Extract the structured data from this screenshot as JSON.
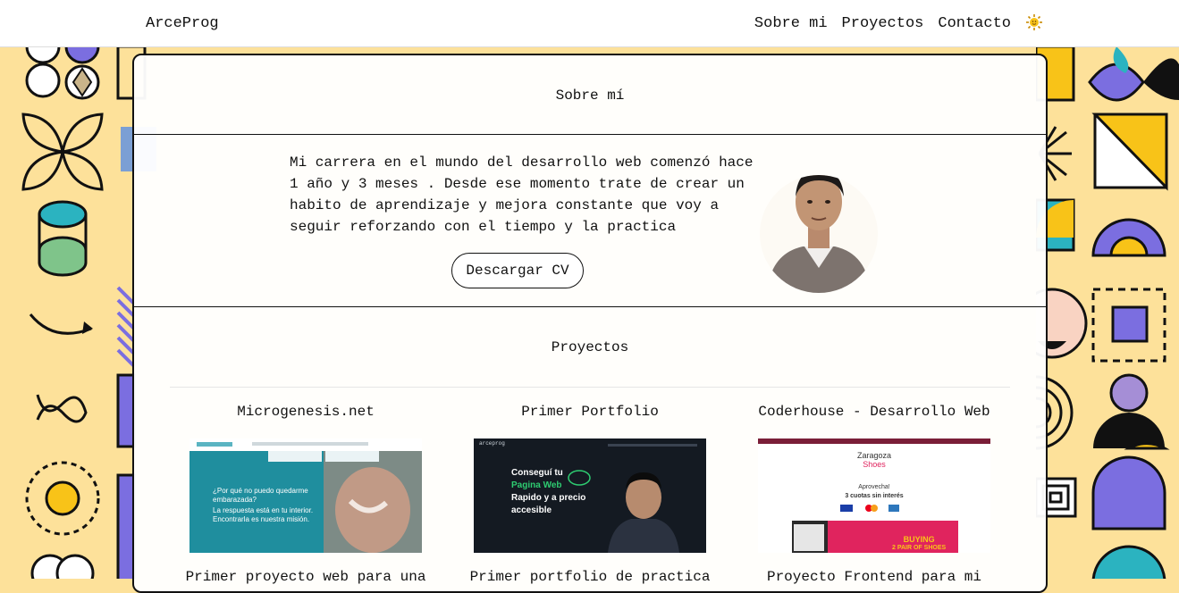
{
  "header": {
    "brand": "ArceProg",
    "nav": [
      "Sobre mi",
      "Proyectos",
      "Contacto"
    ]
  },
  "about": {
    "title": "Sobre mí",
    "text": "Mi carrera en el mundo del desarrollo web comenzó hace 1 año y 3 meses . Desde ese momento trate de crear un habito de aprendizaje y mejora constante que voy a seguir reforzando con el tiempo y la practica",
    "cv_button": "Descargar CV"
  },
  "projects": {
    "title": "Proyectos",
    "items": [
      {
        "name": "Microgenesis.net",
        "description": "Primer proyecto web para una",
        "thumb": {
          "headline": "¿Por qué no puedo quedarme embarazada?",
          "subline": "La respuesta está en tu interior. Encontrarla es nuestra misión."
        }
      },
      {
        "name": "Primer Portfolio",
        "description": "Primer portfolio de practica",
        "thumb": {
          "brand": "arceprog",
          "headline_1": "Conseguí tu",
          "headline_2": "Pagina Web",
          "headline_3": "Rapido y a precio",
          "headline_4": "accesible"
        }
      },
      {
        "name": "Coderhouse - Desarrollo Web",
        "description": "Proyecto Frontend para mi",
        "thumb": {
          "store_1": "Zaragoza",
          "store_2": "Shoes",
          "promo_1": "Aprovecha!",
          "promo_2": "3 cuotas sin interés",
          "banner_1": "BUYING",
          "banner_2": "2 PAIR OF SHOES"
        }
      }
    ]
  },
  "colors": {
    "background": "#fde19a",
    "accent_yellow": "#f8c318",
    "accent_purple": "#7b6ee0",
    "accent_teal": "#2bb3c0"
  }
}
